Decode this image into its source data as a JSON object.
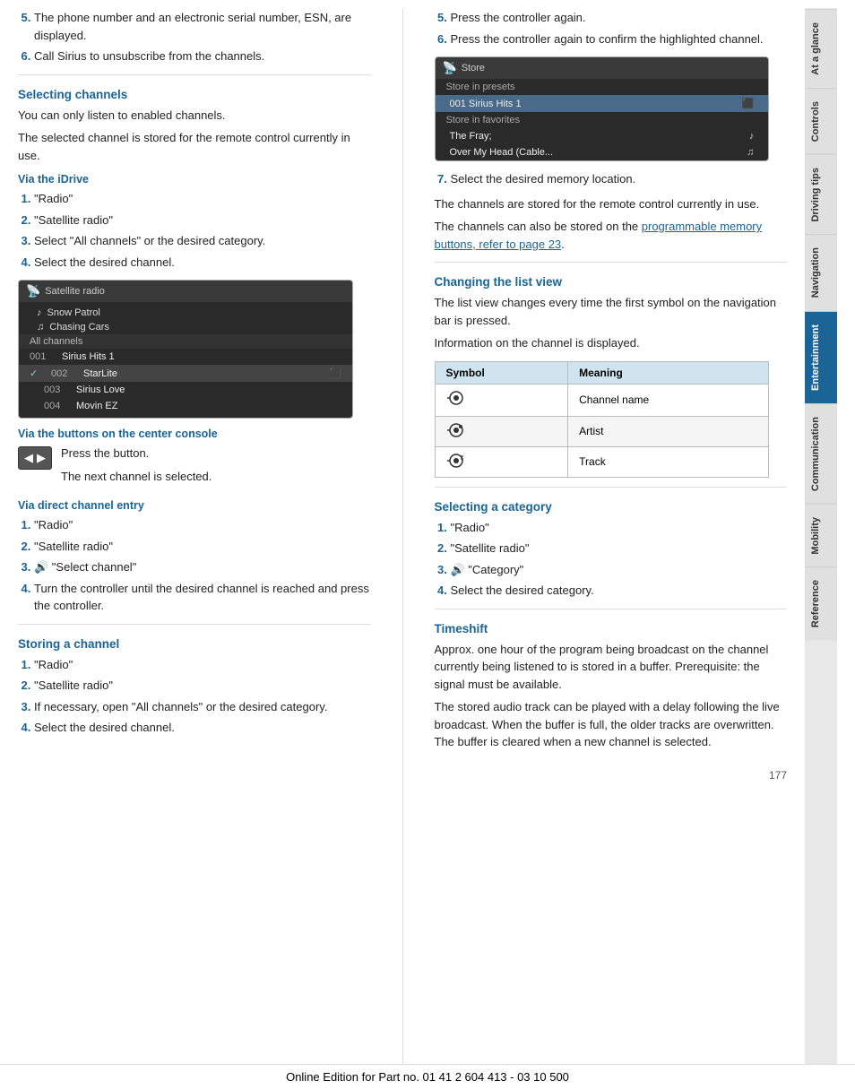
{
  "sidebar": {
    "tabs": [
      {
        "label": "At a glance",
        "active": false
      },
      {
        "label": "Controls",
        "active": false
      },
      {
        "label": "Driving tips",
        "active": false
      },
      {
        "label": "Navigation",
        "active": false
      },
      {
        "label": "Entertainment",
        "active": true
      },
      {
        "label": "Communication",
        "active": false
      },
      {
        "label": "Mobility",
        "active": false
      },
      {
        "label": "Reference",
        "active": false
      }
    ]
  },
  "left": {
    "intro_items": [
      {
        "num": "5",
        "text": "The phone number and an electronic serial number, ESN, are displayed."
      },
      {
        "num": "6",
        "text": "Call Sirius to unsubscribe from the channels."
      }
    ],
    "selecting_channels": {
      "heading": "Selecting channels",
      "para1": "You can only listen to enabled channels.",
      "para2": "The selected channel is stored for the remote control currently in use."
    },
    "via_idrive": {
      "heading": "Via the iDrive",
      "items": [
        {
          "num": "1",
          "text": "\"Radio\""
        },
        {
          "num": "2",
          "text": "\"Satellite radio\""
        },
        {
          "num": "3",
          "text": "Select \"All channels\" or the desired category."
        },
        {
          "num": "4",
          "text": "Select the desired channel."
        }
      ]
    },
    "sat_radio_ui": {
      "title": "Satellite radio",
      "artists": [
        {
          "icon": "♪",
          "name": "Snow Patrol"
        },
        {
          "icon": "♫",
          "name": "Chasing Cars"
        }
      ],
      "group": "All channels",
      "channels": [
        {
          "num": "001",
          "name": "Sirius Hits 1",
          "check": "",
          "icon": ""
        },
        {
          "num": "002",
          "name": "StarLite",
          "check": "✓",
          "icon": "⬛"
        },
        {
          "num": "003",
          "name": "Sirius Love",
          "check": "",
          "icon": ""
        },
        {
          "num": "004",
          "name": "Movin EZ",
          "check": "",
          "icon": ""
        }
      ]
    },
    "via_buttons": {
      "heading": "Via the buttons on the center console",
      "text1": "Press the button.",
      "text2": "The next channel is selected."
    },
    "via_direct": {
      "heading": "Via direct channel entry",
      "items": [
        {
          "num": "1",
          "text": "\"Radio\""
        },
        {
          "num": "2",
          "text": "\"Satellite radio\""
        },
        {
          "num": "3",
          "icon": true,
          "text": "\"Select channel\""
        },
        {
          "num": "4",
          "text": "Turn the controller until the desired channel is reached and press the controller."
        }
      ]
    },
    "storing": {
      "heading": "Storing a channel",
      "items": [
        {
          "num": "1",
          "text": "\"Radio\""
        },
        {
          "num": "2",
          "text": "\"Satellite radio\""
        },
        {
          "num": "3",
          "text": "If necessary, open \"All channels\" or the desired category."
        },
        {
          "num": "4",
          "text": "Select the desired channel."
        }
      ]
    }
  },
  "right": {
    "intro_items": [
      {
        "num": "5",
        "text": "Press the controller again."
      },
      {
        "num": "6",
        "text": "Press the controller again to confirm the highlighted channel."
      }
    ],
    "store_ui": {
      "title": "Store",
      "sections": [
        {
          "label": "Store in presets",
          "rows": [
            {
              "name": "001  Sirius Hits 1",
              "icon": "⬛",
              "highlighted": true
            }
          ]
        },
        {
          "label": "Store in favorites",
          "rows": [
            {
              "name": "The Fray;",
              "icon": "♪",
              "highlighted": false
            },
            {
              "name": "Over My Head (Cable...",
              "icon": "♫",
              "highlighted": false
            }
          ]
        }
      ]
    },
    "step7": "Select the desired memory location.",
    "para_stored": "The channels are stored for the remote control currently in use.",
    "para_also": "The channels can also be stored on the programmable memory buttons, refer to page 23.",
    "changing_list": {
      "heading": "Changing the list view",
      "para1": "The list view changes every time the first symbol on the navigation bar is pressed.",
      "para2": "Information on the channel is displayed.",
      "table": {
        "headers": [
          "Symbol",
          "Meaning"
        ],
        "rows": [
          {
            "symbol": "🔊",
            "meaning": "Channel name"
          },
          {
            "symbol": "🔊",
            "meaning": "Artist"
          },
          {
            "symbol": "🔊",
            "meaning": "Track"
          }
        ]
      }
    },
    "selecting_category": {
      "heading": "Selecting a category",
      "items": [
        {
          "num": "1",
          "text": "\"Radio\""
        },
        {
          "num": "2",
          "text": "\"Satellite radio\""
        },
        {
          "num": "3",
          "icon": true,
          "text": "\"Category\""
        },
        {
          "num": "4",
          "text": "Select the desired category."
        }
      ]
    },
    "timeshift": {
      "heading": "Timeshift",
      "para1": "Approx. one hour of the program being broadcast on the channel currently being listened to is stored in a buffer. Prerequisite: the signal must be available.",
      "para2": "The stored audio track can be played with a delay following the live broadcast. When the buffer is full, the older tracks are overwritten. The buffer is cleared when a new channel is selected."
    }
  },
  "footer": {
    "text": "Online Edition for Part no. 01 41 2 604 413 - 03 10 500",
    "page": "177"
  }
}
